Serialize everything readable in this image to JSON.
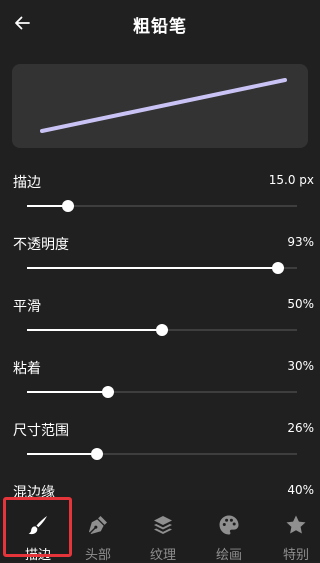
{
  "header": {
    "title": "粗铅笔"
  },
  "preview": {
    "stroke_color": "#c9c3f5"
  },
  "settings": [
    {
      "label": "描边",
      "value": "15.0 px",
      "fraction": 0.15
    },
    {
      "label": "不透明度",
      "value": "93%",
      "fraction": 0.93
    },
    {
      "label": "平滑",
      "value": "50%",
      "fraction": 0.5
    },
    {
      "label": "粘着",
      "value": "30%",
      "fraction": 0.3
    },
    {
      "label": "尺寸范围",
      "value": "26%",
      "fraction": 0.26
    },
    {
      "label": "混边缘",
      "value": "40%",
      "fraction": 0.4
    }
  ],
  "bottom_nav": [
    {
      "label": "描边",
      "icon": "brush-icon",
      "active": true
    },
    {
      "label": "头部",
      "icon": "pen-nib-icon",
      "active": false
    },
    {
      "label": "纹理",
      "icon": "layers-icon",
      "active": false
    },
    {
      "label": "绘画",
      "icon": "palette-icon",
      "active": false
    },
    {
      "label": "特别",
      "icon": "star-icon",
      "active": false
    }
  ],
  "colors": {
    "background": "#202020",
    "accent_highlight": "#e5343a",
    "inactive_nav": "#8f8f8f"
  }
}
